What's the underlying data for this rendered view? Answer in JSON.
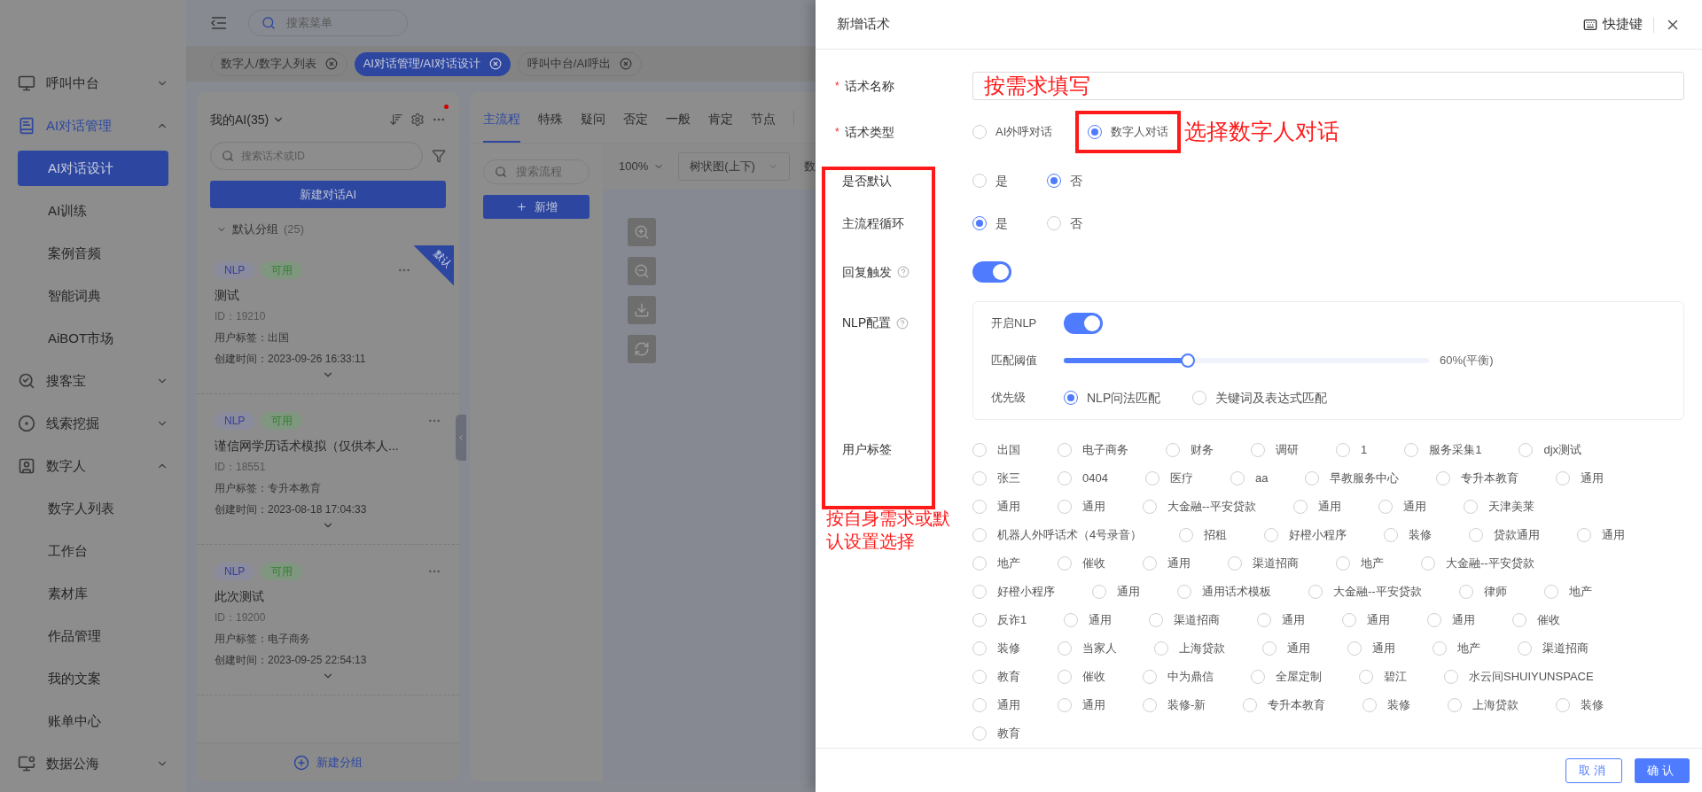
{
  "sidebar": {
    "items": [
      {
        "label": "呼叫中台",
        "selected": false,
        "expanded": false
      },
      {
        "label": "AI对话管理",
        "selected": true,
        "expanded": true,
        "children": [
          {
            "label": "AI对话设计",
            "selected": true
          },
          {
            "label": "AI训练",
            "selected": false
          },
          {
            "label": "案例音频",
            "selected": false
          },
          {
            "label": "智能词典",
            "selected": false
          },
          {
            "label": "AiBOT市场",
            "selected": false
          }
        ]
      },
      {
        "label": "搜客宝",
        "selected": false,
        "expanded": false
      },
      {
        "label": "线索挖掘",
        "selected": false,
        "expanded": false
      },
      {
        "label": "数字人",
        "selected": false,
        "expanded": true,
        "children": [
          {
            "label": "数字人列表",
            "selected": false
          },
          {
            "label": "工作台",
            "selected": false
          },
          {
            "label": "素材库",
            "selected": false
          },
          {
            "label": "作品管理",
            "selected": false
          },
          {
            "label": "我的文案",
            "selected": false
          },
          {
            "label": "账单中心",
            "selected": false
          }
        ]
      },
      {
        "label": "数据公海",
        "selected": false,
        "expanded": false
      }
    ]
  },
  "topbar": {
    "search_placeholder": "搜索菜单"
  },
  "page_tabs": [
    {
      "label": "数字人/数字人列表",
      "selected": false
    },
    {
      "label": "AI对话管理/AI对话设计",
      "selected": true
    },
    {
      "label": "呼叫中台/AI呼出",
      "selected": false
    }
  ],
  "ai_list": {
    "title": "我的AI(35)",
    "search_placeholder": "搜索话术或ID",
    "new_button": "新建对话AI",
    "group": {
      "label": "默认分组",
      "count": "(25)",
      "expanded": true
    },
    "cards": [
      {
        "type": "NLP",
        "status": "可用",
        "name": "测试",
        "id": "ID：19210",
        "user_tag": "用户标签：出国",
        "created": "创建时间：2023-09-26 16:33:11",
        "ribbon": "默认"
      },
      {
        "type": "NLP",
        "status": "可用",
        "name": "谨信网学历话术模拟（仅供本人...",
        "id": "ID：18551",
        "user_tag": "用户标签：专升本教育",
        "created": "创建时间：2023-08-18 17:04:33"
      },
      {
        "type": "NLP",
        "status": "可用",
        "name": "此次测试",
        "id": "ID：19200",
        "user_tag": "用户标签：电子商务",
        "created": "创建时间：2023-09-25 22:54:13"
      }
    ],
    "add_group": "新建分组"
  },
  "flow_panel": {
    "tabs": [
      {
        "label": "主流程",
        "selected": true
      },
      {
        "label": "特殊",
        "selected": false
      },
      {
        "label": "疑问",
        "selected": false
      },
      {
        "label": "否定",
        "selected": false
      },
      {
        "label": "一般",
        "selected": false
      },
      {
        "label": "肯定",
        "selected": false
      },
      {
        "label": "节点",
        "selected": false
      }
    ],
    "search_placeholder": "搜索流程",
    "add_button": "新增",
    "zoom": "100%",
    "layout": "树状图(上下)",
    "cut_label": "数"
  },
  "drawer": {
    "title": "新增话术",
    "shortcut": "快捷键",
    "name_field": {
      "label": "话术名称",
      "required_mark": "*",
      "value": "按需求填写"
    },
    "type_field": {
      "label": "话术类型",
      "required_mark": "*",
      "options": [
        {
          "label": "AI外呼对话",
          "selected": false,
          "highlighted": false
        },
        {
          "label": "数字人对话",
          "selected": true,
          "highlighted": true
        }
      ],
      "note": "选择数字人对话"
    },
    "default_field": {
      "label": "是否默认",
      "options": [
        {
          "label": "是",
          "selected": false
        },
        {
          "label": "否",
          "selected": true
        }
      ]
    },
    "loop_field": {
      "label": "主流程循环",
      "options": [
        {
          "label": "是",
          "selected": true
        },
        {
          "label": "否",
          "selected": false
        }
      ]
    },
    "reply_trigger": {
      "label": "回复触发",
      "on": true
    },
    "nlp": {
      "label": "NLP配置",
      "enable_label": "开启NLP",
      "on": true,
      "threshold_label": "匹配阈值",
      "level": 0.34,
      "reading": "60%(平衡)",
      "priority_label": "优先级",
      "priority_options": [
        {
          "label": "NLP问法匹配",
          "selected": true
        },
        {
          "label": "关键词及表达式匹配",
          "selected": false
        }
      ]
    },
    "user_tags": {
      "label": "用户标签",
      "note": "按自身需求或默认设置选择",
      "options": [
        {
          "label": "出国",
          "selected": false
        },
        {
          "label": "电子商务",
          "selected": false
        },
        {
          "label": "财务",
          "selected": false
        },
        {
          "label": "调研",
          "selected": false
        },
        {
          "label": "1",
          "selected": false
        },
        {
          "label": "服务采集1",
          "selected": false
        },
        {
          "label": "djx测试",
          "selected": false
        },
        {
          "label": "张三",
          "selected": false
        },
        {
          "label": "0404",
          "selected": false
        },
        {
          "label": "医疗",
          "selected": false
        },
        {
          "label": "aa",
          "selected": false
        },
        {
          "label": "早教服务中心",
          "selected": false
        },
        {
          "label": "专升本教育",
          "selected": false
        },
        {
          "label": "通用",
          "selected": false
        },
        {
          "label": "通用",
          "selected": false
        },
        {
          "label": "通用",
          "selected": false
        },
        {
          "label": "大金融--平安贷款",
          "selected": false
        },
        {
          "label": "通用",
          "selected": false
        },
        {
          "label": "通用",
          "selected": false
        },
        {
          "label": "天津美莱",
          "selected": false
        },
        {
          "label": "机器人外呼话术（4号录音）",
          "selected": false
        },
        {
          "label": "招租",
          "selected": false
        },
        {
          "label": "好橙小程序",
          "selected": false
        },
        {
          "label": "装修",
          "selected": false
        },
        {
          "label": "贷款通用",
          "selected": false
        },
        {
          "label": "通用",
          "selected": false
        },
        {
          "label": "地产",
          "selected": false
        },
        {
          "label": "催收",
          "selected": false
        },
        {
          "label": "通用",
          "selected": false
        },
        {
          "label": "渠道招商",
          "selected": false
        },
        {
          "label": "地产",
          "selected": false
        },
        {
          "label": "大金融--平安贷款",
          "selected": false
        },
        {
          "label": "好橙小程序",
          "selected": false
        },
        {
          "label": "通用",
          "selected": false
        },
        {
          "label": "通用话术模板",
          "selected": false
        },
        {
          "label": "大金融--平安贷款",
          "selected": false
        },
        {
          "label": "律师",
          "selected": false
        },
        {
          "label": "地产",
          "selected": false
        },
        {
          "label": "反诈1",
          "selected": false
        },
        {
          "label": "通用",
          "selected": false
        },
        {
          "label": "渠道招商",
          "selected": false
        },
        {
          "label": "通用",
          "selected": false
        },
        {
          "label": "通用",
          "selected": false
        },
        {
          "label": "通用",
          "selected": false
        },
        {
          "label": "催收",
          "selected": false
        },
        {
          "label": "装修",
          "selected": false
        },
        {
          "label": "当家人",
          "selected": false
        },
        {
          "label": "上海贷款",
          "selected": false
        },
        {
          "label": "通用",
          "selected": false
        },
        {
          "label": "通用",
          "selected": false
        },
        {
          "label": "地产",
          "selected": false
        },
        {
          "label": "渠道招商",
          "selected": false
        },
        {
          "label": "教育",
          "selected": false
        },
        {
          "label": "催收",
          "selected": false
        },
        {
          "label": "中为鼎信",
          "selected": false
        },
        {
          "label": "全屋定制",
          "selected": false
        },
        {
          "label": "碧江",
          "selected": false
        },
        {
          "label": "水云间SHUIYUNSPACE",
          "selected": false
        },
        {
          "label": "通用",
          "selected": false
        },
        {
          "label": "通用",
          "selected": false
        },
        {
          "label": "装修-新",
          "selected": false
        },
        {
          "label": "专升本教育",
          "selected": false
        },
        {
          "label": "装修",
          "selected": false
        },
        {
          "label": "上海贷款",
          "selected": false
        },
        {
          "label": "装修",
          "selected": false
        },
        {
          "label": "教育",
          "selected": false
        }
      ]
    },
    "footer": {
      "cancel": "取消",
      "confirm": "确认"
    }
  }
}
